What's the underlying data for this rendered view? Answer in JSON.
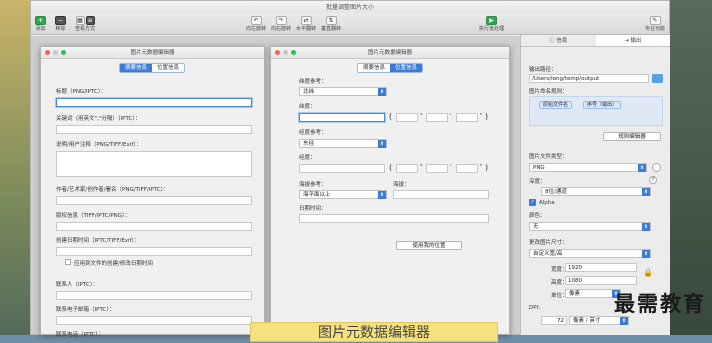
{
  "window": {
    "title": "批量调整图片大小"
  },
  "toolbar": {
    "add": "添加",
    "remove": "移除",
    "view_mode": "查看方式",
    "rotate_left": "向左旋转",
    "rotate_right": "向右旋转",
    "flip_h": "水平翻转",
    "flip_v": "垂直翻转",
    "start_batch": "执行批处理",
    "pro_edition": "专业功能"
  },
  "left_panel": {
    "title": "图片元数据编辑器",
    "tabs": [
      "摘要信息",
      "位置信息"
    ],
    "active_tab": 0,
    "fields": [
      "标题（PNG/IPTC）：",
      "关键词（用英文\",\"分隔）（IPTC）：",
      "说明/用户注释（PNG/TIFF/Exif）：",
      "作者/艺术家/创作者/署名（PNG/TIFF/IPTC）：",
      "版权信息（TIFF/IPTC/PNG）：",
      "创建日期时间（IPTC/TIFF/Exif）：",
      "联系人（IPTC）：",
      "联系电子邮箱（IPTC）："
    ],
    "checkbox_label": "应用到文件的创建/修改日期时间",
    "cut_off": "联系电话（IPTC）："
  },
  "right_panel": {
    "title": "图片元数据编辑器",
    "tabs": [
      "摘要信息",
      "位置信息"
    ],
    "active_tab": 1,
    "lat_ref_label": "纬度参考：",
    "lat_ref_value": "北纬",
    "lat_label": "纬度：",
    "lon_ref_label": "经度参考：",
    "lon_ref_value": "东经",
    "lon_label": "经度：",
    "alt_ref_label": "海拔参考：",
    "alt_ref_value": "海平面以上",
    "alt_label": "海拔：",
    "date_label": "日期时间：",
    "use_location_btn": "使用我的位置",
    "deg": "°",
    "min": "'",
    "sec": "\""
  },
  "inspector": {
    "tabs": [
      "信息",
      "输出"
    ],
    "active_tab": 1,
    "output_path_label": "输出路径：",
    "output_path": "/Users/long/temp/output",
    "naming_label": "图片命名规则：",
    "chip1": "原始文件名",
    "chip2": "序号（输出）",
    "rule_editor_btn": "规则编辑器",
    "format_label": "图片文件类型：",
    "format_value": "PNG",
    "depth_label": "深度：",
    "depth_value": "8位/通道",
    "alpha_label": "Alpha",
    "alpha_checked": true,
    "color_label": "颜色：",
    "color_value": "无",
    "size_label": "更改图片尺寸：",
    "size_mode": "自定义宽/高",
    "width_label": "宽度：",
    "width_value": "1920",
    "height_label": "高度：",
    "height_value": "1080",
    "unit_label": "单位：",
    "unit_value": "像素",
    "dpi_label": "DPI:",
    "dpi_value": "72",
    "dpi_unit": "像素 / 英寸",
    "help": "?"
  },
  "caption": "图片元数据编辑器",
  "watermark": "最需教育"
}
